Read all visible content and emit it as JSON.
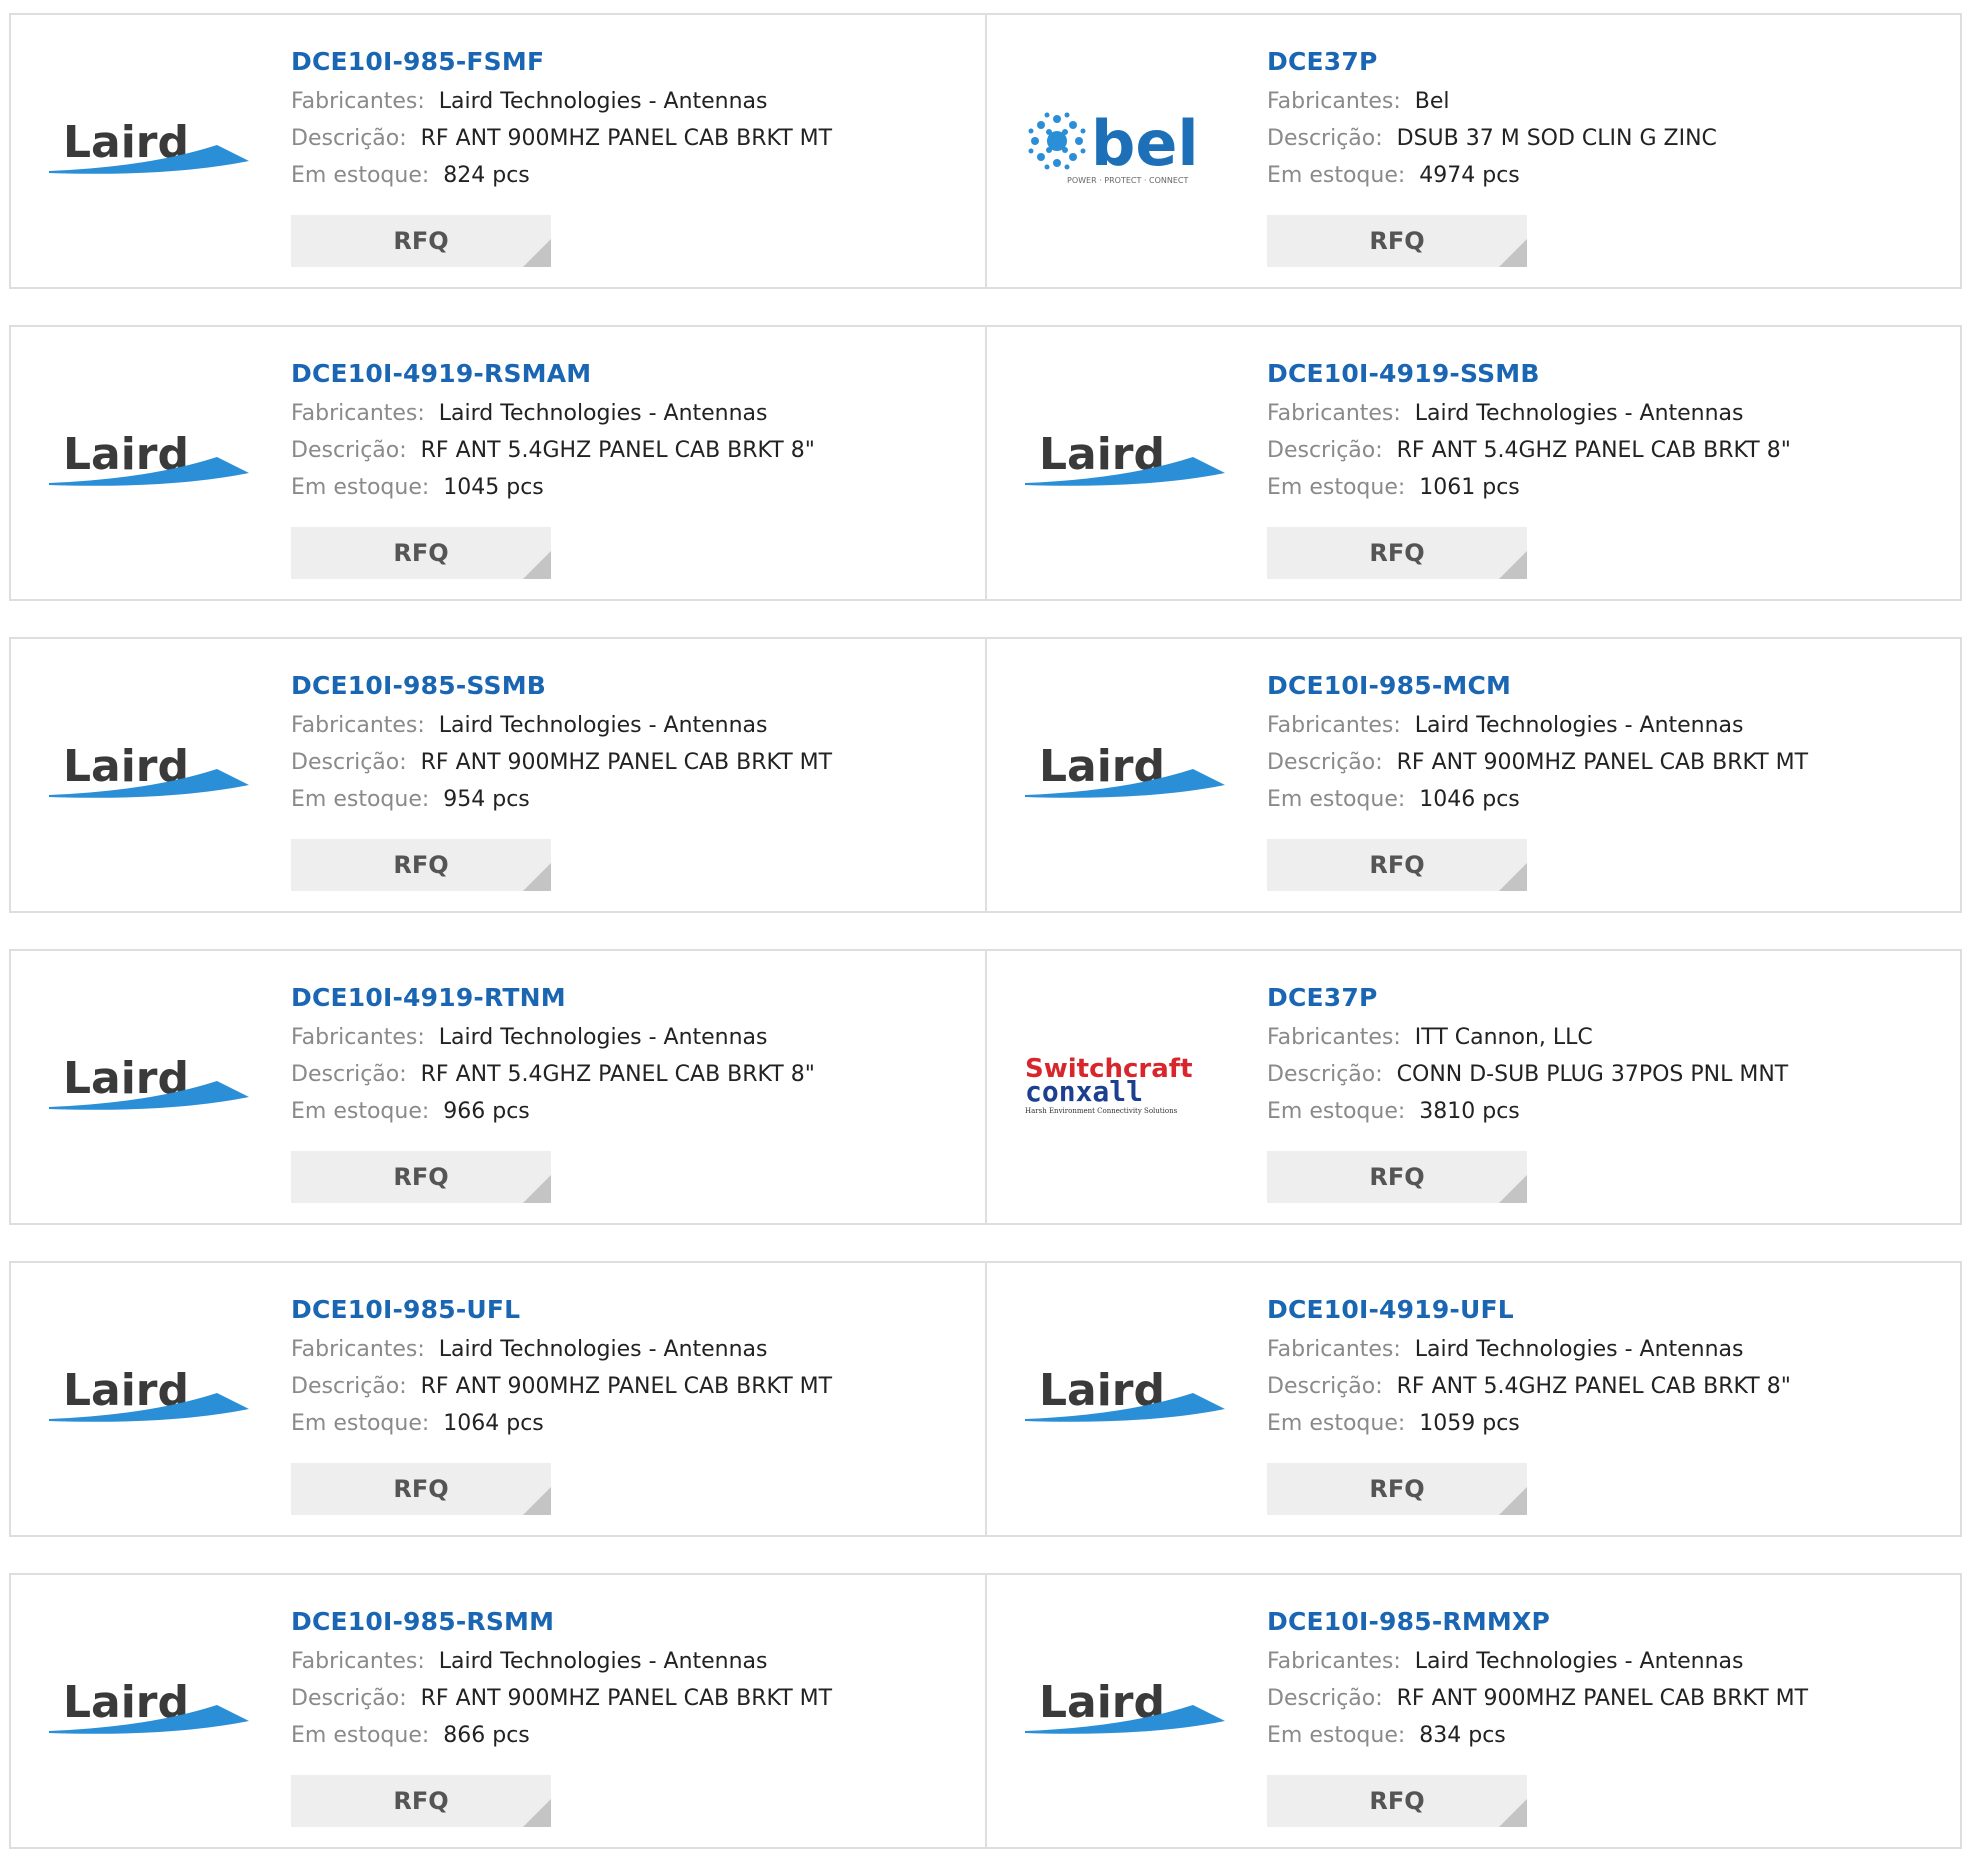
{
  "labels": {
    "manufacturer": "Fabricantes:",
    "description": "Descrição:",
    "stock": "Em estoque:",
    "rfq": "RFQ"
  },
  "colors": {
    "part_link": "#1a66b3",
    "label_gray": "#8a8a8a",
    "button_bg": "#eeeeee"
  },
  "brands": {
    "laird": {
      "name": "Laird",
      "icon": "laird-logo"
    },
    "bel": {
      "name": "bel",
      "tagline": "POWER · PROTECT · CONNECT",
      "icon": "bel-logo"
    },
    "switchcraft": {
      "name1": "Switchcraft",
      "name2": "conxall",
      "tagline": "Harsh Environment Connectivity Solutions",
      "icon": "switchcraft-conxall-logo"
    }
  },
  "products": [
    {
      "part": "DCE10I-985-FSMF",
      "manufacturer": "Laird Technologies - Antennas",
      "description": "RF ANT 900MHZ PANEL CAB BRKT MT",
      "stock": "824 pcs",
      "logo": "laird"
    },
    {
      "part": "DCE37P",
      "manufacturer": "Bel",
      "description": "DSUB 37 M SOD CLIN G ZINC",
      "stock": "4974 pcs",
      "logo": "bel"
    },
    {
      "part": "DCE10I-4919-RSMAM",
      "manufacturer": "Laird Technologies - Antennas",
      "description": "RF ANT 5.4GHZ PANEL CAB BRKT 8\"",
      "stock": "1045 pcs",
      "logo": "laird"
    },
    {
      "part": "DCE10I-4919-SSMB",
      "manufacturer": "Laird Technologies - Antennas",
      "description": "RF ANT 5.4GHZ PANEL CAB BRKT 8\"",
      "stock": "1061 pcs",
      "logo": "laird"
    },
    {
      "part": "DCE10I-985-SSMB",
      "manufacturer": "Laird Technologies - Antennas",
      "description": "RF ANT 900MHZ PANEL CAB BRKT MT",
      "stock": "954 pcs",
      "logo": "laird"
    },
    {
      "part": "DCE10I-985-MCM",
      "manufacturer": "Laird Technologies - Antennas",
      "description": "RF ANT 900MHZ PANEL CAB BRKT MT",
      "stock": "1046 pcs",
      "logo": "laird"
    },
    {
      "part": "DCE10I-4919-RTNM",
      "manufacturer": "Laird Technologies - Antennas",
      "description": "RF ANT 5.4GHZ PANEL CAB BRKT 8\"",
      "stock": "966 pcs",
      "logo": "laird"
    },
    {
      "part": "DCE37P",
      "manufacturer": "ITT Cannon, LLC",
      "description": "CONN D-SUB PLUG 37POS PNL MNT",
      "stock": "3810 pcs",
      "logo": "switchcraft"
    },
    {
      "part": "DCE10I-985-UFL",
      "manufacturer": "Laird Technologies - Antennas",
      "description": "RF ANT 900MHZ PANEL CAB BRKT MT",
      "stock": "1064 pcs",
      "logo": "laird"
    },
    {
      "part": "DCE10I-4919-UFL",
      "manufacturer": "Laird Technologies - Antennas",
      "description": "RF ANT 5.4GHZ PANEL CAB BRKT 8\"",
      "stock": "1059 pcs",
      "logo": "laird"
    },
    {
      "part": "DCE10I-985-RSMM",
      "manufacturer": "Laird Technologies - Antennas",
      "description": "RF ANT 900MHZ PANEL CAB BRKT MT",
      "stock": "866 pcs",
      "logo": "laird"
    },
    {
      "part": "DCE10I-985-RMMXP",
      "manufacturer": "Laird Technologies - Antennas",
      "description": "RF ANT 900MHZ PANEL CAB BRKT MT",
      "stock": "834 pcs",
      "logo": "laird"
    }
  ]
}
